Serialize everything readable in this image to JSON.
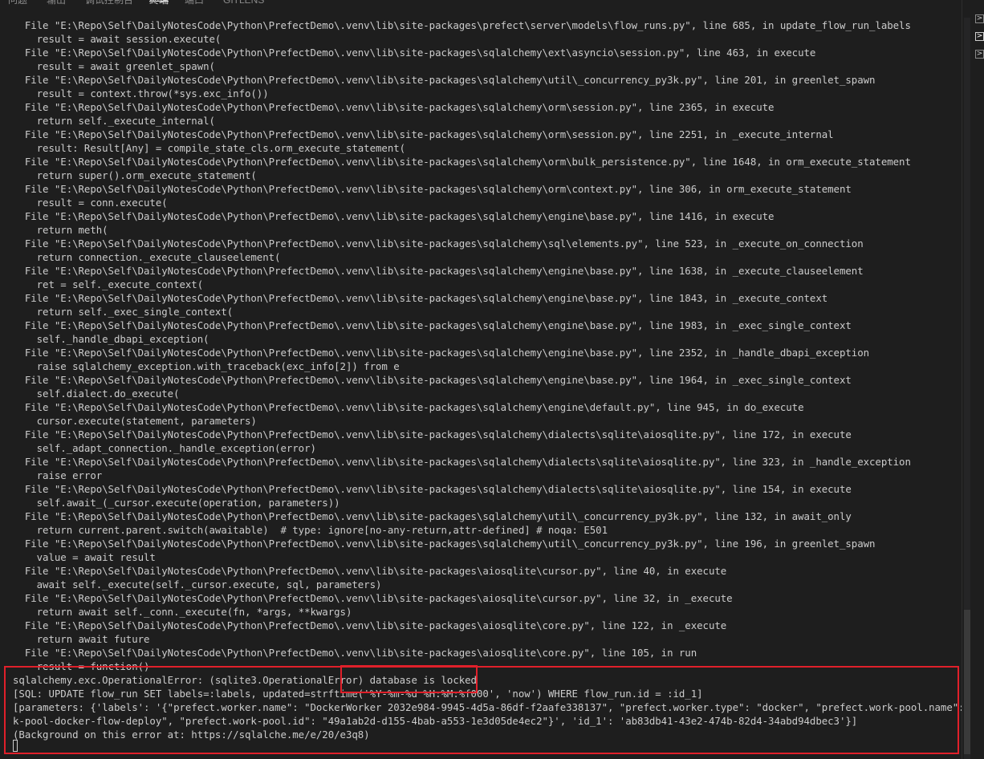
{
  "tabs": [
    {
      "label": "问题",
      "active": false
    },
    {
      "label": "输出",
      "active": false
    },
    {
      "label": "调试控制台",
      "active": false
    },
    {
      "label": "终端",
      "active": true
    },
    {
      "label": "端口",
      "active": false
    },
    {
      "label": "GITLENS",
      "active": false
    }
  ],
  "terminal_lines": [
    "  File \"E:\\Repo\\Self\\DailyNotesCode\\Python\\PrefectDemo\\.venv\\lib\\site-packages\\prefect\\server\\models\\flow_runs.py\", line 685, in update_flow_run_labels",
    "    result = await session.execute(",
    "  File \"E:\\Repo\\Self\\DailyNotesCode\\Python\\PrefectDemo\\.venv\\lib\\site-packages\\sqlalchemy\\ext\\asyncio\\session.py\", line 463, in execute",
    "    result = await greenlet_spawn(",
    "  File \"E:\\Repo\\Self\\DailyNotesCode\\Python\\PrefectDemo\\.venv\\lib\\site-packages\\sqlalchemy\\util\\_concurrency_py3k.py\", line 201, in greenlet_spawn",
    "    result = context.throw(*sys.exc_info())",
    "  File \"E:\\Repo\\Self\\DailyNotesCode\\Python\\PrefectDemo\\.venv\\lib\\site-packages\\sqlalchemy\\orm\\session.py\", line 2365, in execute",
    "    return self._execute_internal(",
    "  File \"E:\\Repo\\Self\\DailyNotesCode\\Python\\PrefectDemo\\.venv\\lib\\site-packages\\sqlalchemy\\orm\\session.py\", line 2251, in _execute_internal",
    "    result: Result[Any] = compile_state_cls.orm_execute_statement(",
    "  File \"E:\\Repo\\Self\\DailyNotesCode\\Python\\PrefectDemo\\.venv\\lib\\site-packages\\sqlalchemy\\orm\\bulk_persistence.py\", line 1648, in orm_execute_statement",
    "    return super().orm_execute_statement(",
    "  File \"E:\\Repo\\Self\\DailyNotesCode\\Python\\PrefectDemo\\.venv\\lib\\site-packages\\sqlalchemy\\orm\\context.py\", line 306, in orm_execute_statement",
    "    result = conn.execute(",
    "  File \"E:\\Repo\\Self\\DailyNotesCode\\Python\\PrefectDemo\\.venv\\lib\\site-packages\\sqlalchemy\\engine\\base.py\", line 1416, in execute",
    "    return meth(",
    "  File \"E:\\Repo\\Self\\DailyNotesCode\\Python\\PrefectDemo\\.venv\\lib\\site-packages\\sqlalchemy\\sql\\elements.py\", line 523, in _execute_on_connection",
    "    return connection._execute_clauseelement(",
    "  File \"E:\\Repo\\Self\\DailyNotesCode\\Python\\PrefectDemo\\.venv\\lib\\site-packages\\sqlalchemy\\engine\\base.py\", line 1638, in _execute_clauseelement",
    "    ret = self._execute_context(",
    "  File \"E:\\Repo\\Self\\DailyNotesCode\\Python\\PrefectDemo\\.venv\\lib\\site-packages\\sqlalchemy\\engine\\base.py\", line 1843, in _execute_context",
    "    return self._exec_single_context(",
    "  File \"E:\\Repo\\Self\\DailyNotesCode\\Python\\PrefectDemo\\.venv\\lib\\site-packages\\sqlalchemy\\engine\\base.py\", line 1983, in _exec_single_context",
    "    self._handle_dbapi_exception(",
    "  File \"E:\\Repo\\Self\\DailyNotesCode\\Python\\PrefectDemo\\.venv\\lib\\site-packages\\sqlalchemy\\engine\\base.py\", line 2352, in _handle_dbapi_exception",
    "    raise sqlalchemy_exception.with_traceback(exc_info[2]) from e",
    "  File \"E:\\Repo\\Self\\DailyNotesCode\\Python\\PrefectDemo\\.venv\\lib\\site-packages\\sqlalchemy\\engine\\base.py\", line 1964, in _exec_single_context",
    "    self.dialect.do_execute(",
    "  File \"E:\\Repo\\Self\\DailyNotesCode\\Python\\PrefectDemo\\.venv\\lib\\site-packages\\sqlalchemy\\engine\\default.py\", line 945, in do_execute",
    "    cursor.execute(statement, parameters)",
    "  File \"E:\\Repo\\Self\\DailyNotesCode\\Python\\PrefectDemo\\.venv\\lib\\site-packages\\sqlalchemy\\dialects\\sqlite\\aiosqlite.py\", line 172, in execute",
    "    self._adapt_connection._handle_exception(error)",
    "  File \"E:\\Repo\\Self\\DailyNotesCode\\Python\\PrefectDemo\\.venv\\lib\\site-packages\\sqlalchemy\\dialects\\sqlite\\aiosqlite.py\", line 323, in _handle_exception",
    "    raise error",
    "  File \"E:\\Repo\\Self\\DailyNotesCode\\Python\\PrefectDemo\\.venv\\lib\\site-packages\\sqlalchemy\\dialects\\sqlite\\aiosqlite.py\", line 154, in execute",
    "    self.await_(_cursor.execute(operation, parameters))",
    "  File \"E:\\Repo\\Self\\DailyNotesCode\\Python\\PrefectDemo\\.venv\\lib\\site-packages\\sqlalchemy\\util\\_concurrency_py3k.py\", line 132, in await_only",
    "    return current.parent.switch(awaitable)  # type: ignore[no-any-return,attr-defined] # noqa: E501",
    "  File \"E:\\Repo\\Self\\DailyNotesCode\\Python\\PrefectDemo\\.venv\\lib\\site-packages\\sqlalchemy\\util\\_concurrency_py3k.py\", line 196, in greenlet_spawn",
    "    value = await result",
    "  File \"E:\\Repo\\Self\\DailyNotesCode\\Python\\PrefectDemo\\.venv\\lib\\site-packages\\aiosqlite\\cursor.py\", line 40, in execute",
    "    await self._execute(self._cursor.execute, sql, parameters)",
    "  File \"E:\\Repo\\Self\\DailyNotesCode\\Python\\PrefectDemo\\.venv\\lib\\site-packages\\aiosqlite\\cursor.py\", line 32, in _execute",
    "    return await self._conn._execute(fn, *args, **kwargs)",
    "  File \"E:\\Repo\\Self\\DailyNotesCode\\Python\\PrefectDemo\\.venv\\lib\\site-packages\\aiosqlite\\core.py\", line 122, in _execute",
    "    return await future",
    "  File \"E:\\Repo\\Self\\DailyNotesCode\\Python\\PrefectDemo\\.venv\\lib\\site-packages\\aiosqlite\\core.py\", line 105, in run",
    "    result = function()",
    "sqlalchemy.exc.OperationalError: (sqlite3.OperationalError) database is locked",
    "[SQL: UPDATE flow_run SET labels=:labels, updated=strftime('%Y-%m-%d %H:%M:%f000', 'now') WHERE flow_run.id = :id_1]",
    "[parameters: {'labels': '{\"prefect.worker.name\": \"DockerWorker 2032e984-9945-4d5a-86df-f2aafe338137\", \"prefect.worker.type\": \"docker\", \"prefect.work-pool.name\": \"my-wor",
    "k-pool-docker-flow-deploy\", \"prefect.work-pool.id\": \"49a1ab2d-d155-4bab-a553-1e3d05de4ec2\"}', 'id_1': 'ab83db41-43e2-474b-82d4-34abd94dbec3'}]",
    "(Background on this error at: https://sqlalche.me/e/20/e3q8)"
  ],
  "side_icons": [
    {
      "icon": "terminal-shell-icon",
      "active": false
    },
    {
      "icon": "terminal-shell-icon",
      "active": true
    },
    {
      "icon": "terminal-shell-icon",
      "active": false
    }
  ],
  "colors": {
    "background": "#1e1e1e",
    "text": "#cccccc",
    "annotation": "#e0202a"
  }
}
